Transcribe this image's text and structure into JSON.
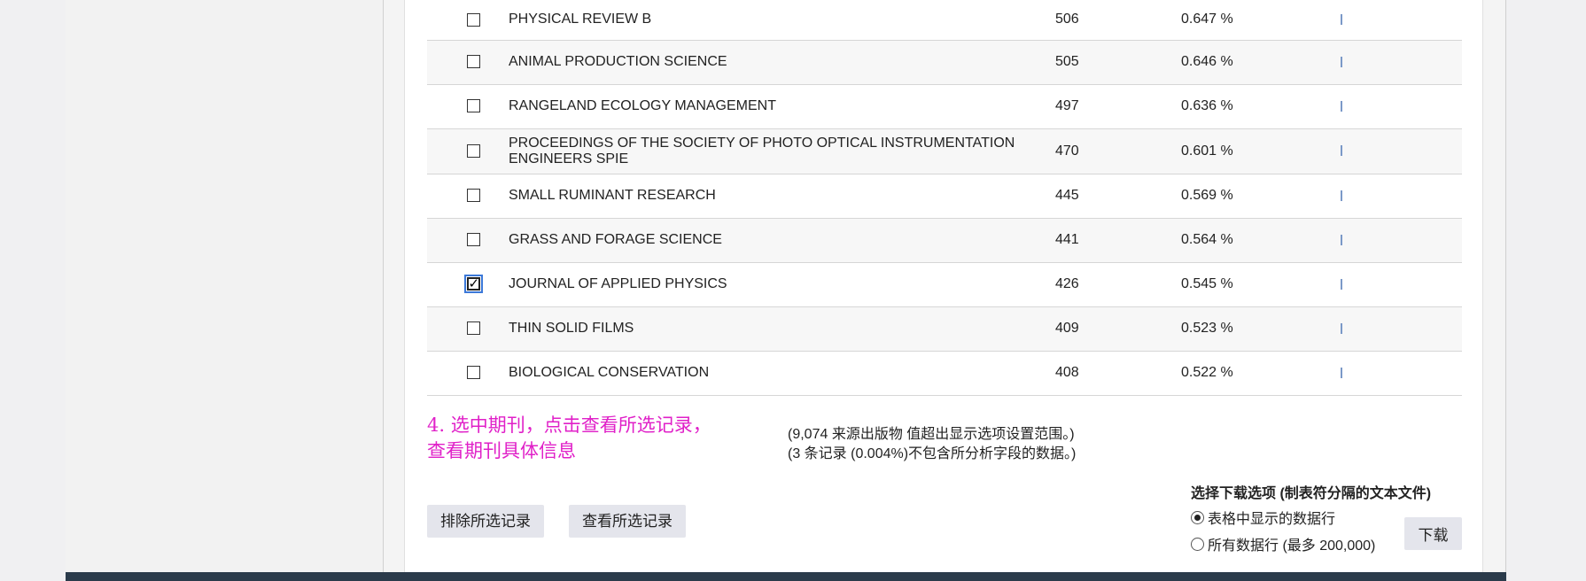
{
  "table": {
    "rows": [
      {
        "name": "PHYSICAL REVIEW B",
        "count": "506",
        "percent": "0.647 %",
        "checked": false
      },
      {
        "name": "ANIMAL PRODUCTION SCIENCE",
        "count": "505",
        "percent": "0.646 %",
        "checked": false
      },
      {
        "name": "RANGELAND ECOLOGY MANAGEMENT",
        "count": "497",
        "percent": "0.636 %",
        "checked": false
      },
      {
        "name": "PROCEEDINGS OF THE SOCIETY OF PHOTO OPTICAL INSTRUMENTATION ENGINEERS SPIE",
        "count": "470",
        "percent": "0.601 %",
        "checked": false
      },
      {
        "name": "SMALL RUMINANT RESEARCH",
        "count": "445",
        "percent": "0.569 %",
        "checked": false
      },
      {
        "name": "GRASS AND FORAGE SCIENCE",
        "count": "441",
        "percent": "0.564 %",
        "checked": false
      },
      {
        "name": "JOURNAL OF APPLIED PHYSICS",
        "count": "426",
        "percent": "0.545 %",
        "checked": true
      },
      {
        "name": "THIN SOLID FILMS",
        "count": "409",
        "percent": "0.523 %",
        "checked": false
      },
      {
        "name": "BIOLOGICAL CONSERVATION",
        "count": "408",
        "percent": "0.522 %",
        "checked": false
      }
    ]
  },
  "annotation": {
    "line1": "4. 选中期刊，点击查看所选记录，",
    "line2": "查看期刊具体信息"
  },
  "notes": {
    "line1": "(9,074 来源出版物 值超出显示选项设置范围。)",
    "line2": "(3 条记录 (0.004%)不包含所分析字段的数据。)"
  },
  "actions": {
    "exclude_label": "排除所选记录",
    "view_label": "查看所选记录"
  },
  "download": {
    "title": "选择下载选项 (制表符分隔的文本文件)",
    "option_displayed": "表格中显示的数据行",
    "option_all": "所有数据行 (最多 200,000)",
    "selected": "displayed",
    "button_label": "下载"
  },
  "colors": {
    "annotation": "#e020c8",
    "bar": "#7b99c8",
    "footer": "#2b3b4b"
  }
}
